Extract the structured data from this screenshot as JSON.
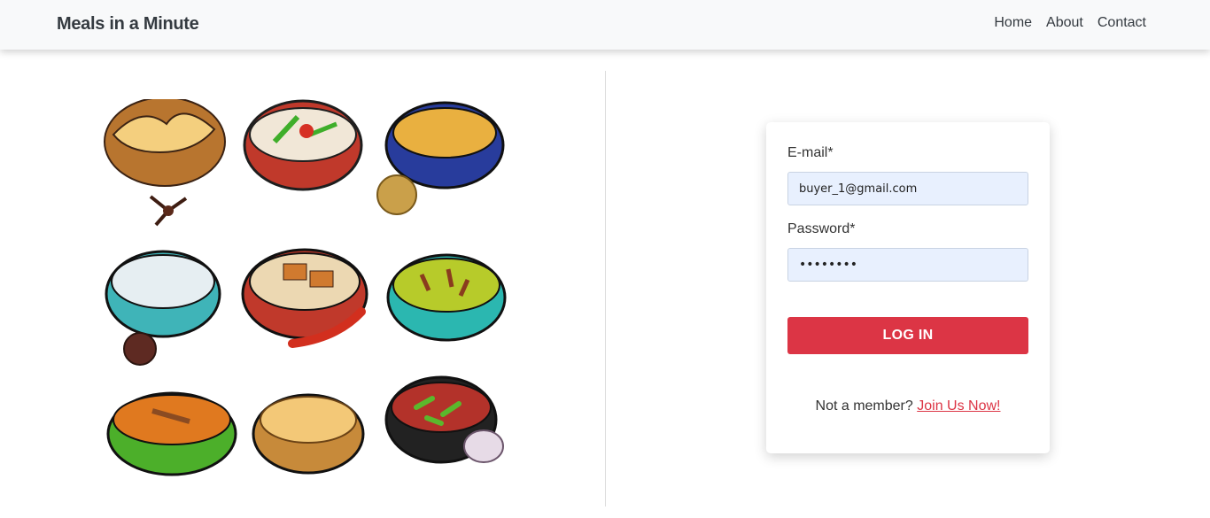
{
  "navbar": {
    "brand": "Meals in a Minute",
    "links": [
      "Home",
      "About",
      "Contact"
    ]
  },
  "illustration": {
    "icon": "food-bowls-illustration",
    "bowls": [
      "bread-basket",
      "curry-bowl-chili",
      "dal-bowl",
      "rice-bowl",
      "chicken-rice-bowl",
      "green-curry-bowl",
      "spice-curry-bowl",
      "flatbread-bowl",
      "red-curry-bowl"
    ]
  },
  "login": {
    "email_label": "E-mail*",
    "email_value": "buyer_1@gmail.com",
    "password_label": "Password*",
    "password_value": "••••••••",
    "button_label": "LOG IN",
    "prompt_text": "Not a member?",
    "join_link": "Join Us Now!"
  },
  "colors": {
    "accent": "#dc3545",
    "navbar_bg": "#f8f9fa",
    "input_bg": "#e8f0fe"
  }
}
